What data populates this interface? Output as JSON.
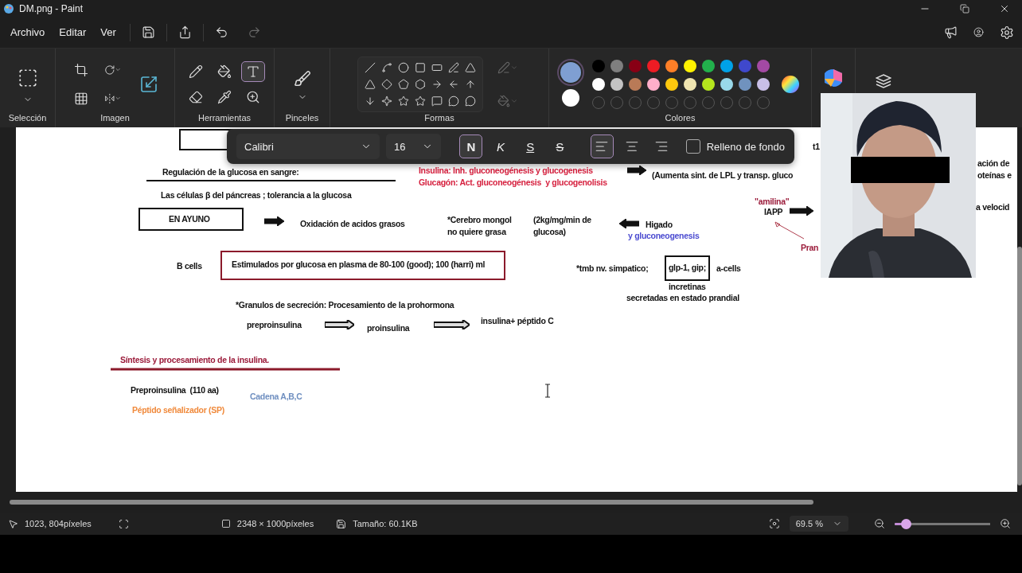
{
  "window": {
    "title": "DM.png - Paint"
  },
  "menu": [
    "Archivo",
    "Editar",
    "Ver"
  ],
  "ribbon": {
    "groups": [
      "Selección",
      "Imagen",
      "Herramientas",
      "Pinceles",
      "Formas",
      "Colores"
    ],
    "tools": [
      {
        "kind": "pencil",
        "selected": false
      },
      {
        "kind": "fill",
        "selected": false
      },
      {
        "kind": "text",
        "selected": true
      },
      {
        "kind": "eraser",
        "selected": false
      },
      {
        "kind": "picker",
        "selected": false
      },
      {
        "kind": "magnifier",
        "selected": false
      }
    ],
    "active_colors": [
      {
        "color": "#7f9fd2"
      },
      {
        "color": "#ffffff"
      }
    ],
    "swatches": [
      {
        "color": "#000000"
      },
      {
        "color": "#7f7f7f"
      },
      {
        "color": "#880015"
      },
      {
        "color": "#ed1c24"
      },
      {
        "color": "#ff7f27"
      },
      {
        "color": "#fff200"
      },
      {
        "color": "#22b14c"
      },
      {
        "color": "#00a2e8"
      },
      {
        "color": "#3f48cc"
      },
      {
        "color": "#a349a4"
      },
      {
        "color": "#ffffff"
      },
      {
        "color": "#c3c3c3"
      },
      {
        "color": "#b97a57"
      },
      {
        "color": "#ffaec9"
      },
      {
        "color": "#ffc90e"
      },
      {
        "color": "#efe4b0"
      },
      {
        "color": "#b5e61d"
      },
      {
        "color": "#99d9ea"
      },
      {
        "color": "#7092be"
      },
      {
        "color": "#c8bfe7"
      }
    ]
  },
  "text_toolbar": {
    "font": "Calibri",
    "size": "16",
    "styles": [
      {
        "kind": "bold",
        "label": "N",
        "selected": true
      },
      {
        "kind": "italic",
        "label": "K",
        "selected": false
      },
      {
        "kind": "underline",
        "label": "S",
        "selected": false
      },
      {
        "kind": "strike",
        "label": "S",
        "selected": false
      }
    ],
    "align": [
      {
        "kind": "left",
        "selected": true
      },
      {
        "kind": "center",
        "selected": false
      },
      {
        "kind": "right",
        "selected": false
      }
    ],
    "background_fill": {
      "label": "Relleno de fondo",
      "checked": false
    }
  },
  "canvas": {
    "items": [
      {
        "kind": "text",
        "text": "Regulación de la glucosa en sangre:",
        "color": "#111111"
      },
      {
        "kind": "text",
        "text": "Las células β del páncreas ; tolerancia a la glucosa",
        "color": "#111111"
      },
      {
        "kind": "boxed",
        "text": "EN AYUNO",
        "color": "#111111"
      },
      {
        "kind": "text",
        "text": "Oxidación de acidos grasos",
        "color": "#111111"
      },
      {
        "kind": "text",
        "text": "*Cerebro mongol\nno quiere grasa",
        "color": "#111111"
      },
      {
        "kind": "text",
        "text": "(2kg/mg/min de\nglucosa)",
        "color": "#111111"
      },
      {
        "kind": "text",
        "text": "Higado",
        "color": "#111111"
      },
      {
        "kind": "text",
        "text": "y gluconeogenesis",
        "color": "#4b4bd0"
      },
      {
        "kind": "text",
        "text": "Insulina: Inh. gluconeogénesis y glucogenesis",
        "color": "#d6213f"
      },
      {
        "kind": "text",
        "text": "Glucagón: Act. gluconeogénesis  y glucogenolisis",
        "color": "#d6213f"
      },
      {
        "kind": "text",
        "text": "(Aumenta sint. de LPL y transp. gluco",
        "color": "#111111"
      },
      {
        "kind": "text",
        "text": "t1",
        "color": "#111111"
      },
      {
        "kind": "text",
        "text": "ación de",
        "color": "#111111"
      },
      {
        "kind": "text",
        "text": "oteínas e",
        "color": "#111111"
      },
      {
        "kind": "text",
        "text": "\"amilina\"",
        "color": "#9b1b3a"
      },
      {
        "kind": "text",
        "text": "IAPP",
        "color": "#111111"
      },
      {
        "kind": "text",
        "text": "Pran",
        "color": "#9b1b3a"
      },
      {
        "kind": "text",
        "text": "a velocid",
        "color": "#111111"
      },
      {
        "kind": "text",
        "text": "B cells",
        "color": "#111111"
      },
      {
        "kind": "boxed",
        "text": "Estimulados por glucosa en plasma de 80-100 (good); 100 (harri) ml",
        "color": "#111111"
      },
      {
        "kind": "text",
        "text": "*tmb nv. simpatico;",
        "color": "#111111"
      },
      {
        "kind": "boxed",
        "text": "glp-1, gip;",
        "color": "#111111"
      },
      {
        "kind": "text",
        "text": "a-cells",
        "color": "#111111"
      },
      {
        "kind": "text",
        "text": "incretinas",
        "color": "#111111"
      },
      {
        "kind": "text",
        "text": "secretadas en estado prandial",
        "color": "#111111"
      },
      {
        "kind": "text",
        "text": "*Granulos de secreción: Procesamiento de la prohormona",
        "color": "#111111"
      },
      {
        "kind": "text",
        "text": "preproinsulina",
        "color": "#111111"
      },
      {
        "kind": "text",
        "text": "proinsulina",
        "color": "#111111"
      },
      {
        "kind": "text",
        "text": "insulina+ péptido C",
        "color": "#111111"
      },
      {
        "kind": "text",
        "text": "Síntesis y procesamiento de la insulina.",
        "color": "#9b1b3a"
      },
      {
        "kind": "text",
        "text": "Preproinsulina  (110 aa)",
        "color": "#111111"
      },
      {
        "kind": "text",
        "text": "Cadena A,B,C",
        "color": "#6f8fc0"
      },
      {
        "kind": "text",
        "text": "Péptido señalizador (SP)",
        "color": "#f08a3c"
      }
    ]
  },
  "webcam": {
    "kind": "picture"
  },
  "status": {
    "cursor": "1023, 804píxeles",
    "dimensions": "2348 × 1000píxeles",
    "size": "Tamaño: 60.1KB",
    "zoom": "69.5 %"
  },
  "zoom_slider": {
    "level": 0.12
  }
}
